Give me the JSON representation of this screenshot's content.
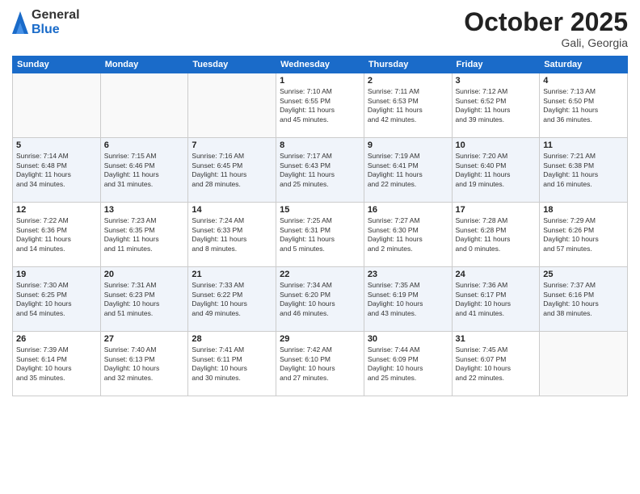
{
  "logo": {
    "general": "General",
    "blue": "Blue"
  },
  "title": "October 2025",
  "location": "Gali, Georgia",
  "headers": [
    "Sunday",
    "Monday",
    "Tuesday",
    "Wednesday",
    "Thursday",
    "Friday",
    "Saturday"
  ],
  "weeks": [
    [
      {
        "day": "",
        "info": ""
      },
      {
        "day": "",
        "info": ""
      },
      {
        "day": "",
        "info": ""
      },
      {
        "day": "1",
        "info": "Sunrise: 7:10 AM\nSunset: 6:55 PM\nDaylight: 11 hours\nand 45 minutes."
      },
      {
        "day": "2",
        "info": "Sunrise: 7:11 AM\nSunset: 6:53 PM\nDaylight: 11 hours\nand 42 minutes."
      },
      {
        "day": "3",
        "info": "Sunrise: 7:12 AM\nSunset: 6:52 PM\nDaylight: 11 hours\nand 39 minutes."
      },
      {
        "day": "4",
        "info": "Sunrise: 7:13 AM\nSunset: 6:50 PM\nDaylight: 11 hours\nand 36 minutes."
      }
    ],
    [
      {
        "day": "5",
        "info": "Sunrise: 7:14 AM\nSunset: 6:48 PM\nDaylight: 11 hours\nand 34 minutes."
      },
      {
        "day": "6",
        "info": "Sunrise: 7:15 AM\nSunset: 6:46 PM\nDaylight: 11 hours\nand 31 minutes."
      },
      {
        "day": "7",
        "info": "Sunrise: 7:16 AM\nSunset: 6:45 PM\nDaylight: 11 hours\nand 28 minutes."
      },
      {
        "day": "8",
        "info": "Sunrise: 7:17 AM\nSunset: 6:43 PM\nDaylight: 11 hours\nand 25 minutes."
      },
      {
        "day": "9",
        "info": "Sunrise: 7:19 AM\nSunset: 6:41 PM\nDaylight: 11 hours\nand 22 minutes."
      },
      {
        "day": "10",
        "info": "Sunrise: 7:20 AM\nSunset: 6:40 PM\nDaylight: 11 hours\nand 19 minutes."
      },
      {
        "day": "11",
        "info": "Sunrise: 7:21 AM\nSunset: 6:38 PM\nDaylight: 11 hours\nand 16 minutes."
      }
    ],
    [
      {
        "day": "12",
        "info": "Sunrise: 7:22 AM\nSunset: 6:36 PM\nDaylight: 11 hours\nand 14 minutes."
      },
      {
        "day": "13",
        "info": "Sunrise: 7:23 AM\nSunset: 6:35 PM\nDaylight: 11 hours\nand 11 minutes."
      },
      {
        "day": "14",
        "info": "Sunrise: 7:24 AM\nSunset: 6:33 PM\nDaylight: 11 hours\nand 8 minutes."
      },
      {
        "day": "15",
        "info": "Sunrise: 7:25 AM\nSunset: 6:31 PM\nDaylight: 11 hours\nand 5 minutes."
      },
      {
        "day": "16",
        "info": "Sunrise: 7:27 AM\nSunset: 6:30 PM\nDaylight: 11 hours\nand 2 minutes."
      },
      {
        "day": "17",
        "info": "Sunrise: 7:28 AM\nSunset: 6:28 PM\nDaylight: 11 hours\nand 0 minutes."
      },
      {
        "day": "18",
        "info": "Sunrise: 7:29 AM\nSunset: 6:26 PM\nDaylight: 10 hours\nand 57 minutes."
      }
    ],
    [
      {
        "day": "19",
        "info": "Sunrise: 7:30 AM\nSunset: 6:25 PM\nDaylight: 10 hours\nand 54 minutes."
      },
      {
        "day": "20",
        "info": "Sunrise: 7:31 AM\nSunset: 6:23 PM\nDaylight: 10 hours\nand 51 minutes."
      },
      {
        "day": "21",
        "info": "Sunrise: 7:33 AM\nSunset: 6:22 PM\nDaylight: 10 hours\nand 49 minutes."
      },
      {
        "day": "22",
        "info": "Sunrise: 7:34 AM\nSunset: 6:20 PM\nDaylight: 10 hours\nand 46 minutes."
      },
      {
        "day": "23",
        "info": "Sunrise: 7:35 AM\nSunset: 6:19 PM\nDaylight: 10 hours\nand 43 minutes."
      },
      {
        "day": "24",
        "info": "Sunrise: 7:36 AM\nSunset: 6:17 PM\nDaylight: 10 hours\nand 41 minutes."
      },
      {
        "day": "25",
        "info": "Sunrise: 7:37 AM\nSunset: 6:16 PM\nDaylight: 10 hours\nand 38 minutes."
      }
    ],
    [
      {
        "day": "26",
        "info": "Sunrise: 7:39 AM\nSunset: 6:14 PM\nDaylight: 10 hours\nand 35 minutes."
      },
      {
        "day": "27",
        "info": "Sunrise: 7:40 AM\nSunset: 6:13 PM\nDaylight: 10 hours\nand 32 minutes."
      },
      {
        "day": "28",
        "info": "Sunrise: 7:41 AM\nSunset: 6:11 PM\nDaylight: 10 hours\nand 30 minutes."
      },
      {
        "day": "29",
        "info": "Sunrise: 7:42 AM\nSunset: 6:10 PM\nDaylight: 10 hours\nand 27 minutes."
      },
      {
        "day": "30",
        "info": "Sunrise: 7:44 AM\nSunset: 6:09 PM\nDaylight: 10 hours\nand 25 minutes."
      },
      {
        "day": "31",
        "info": "Sunrise: 7:45 AM\nSunset: 6:07 PM\nDaylight: 10 hours\nand 22 minutes."
      },
      {
        "day": "",
        "info": ""
      }
    ]
  ]
}
